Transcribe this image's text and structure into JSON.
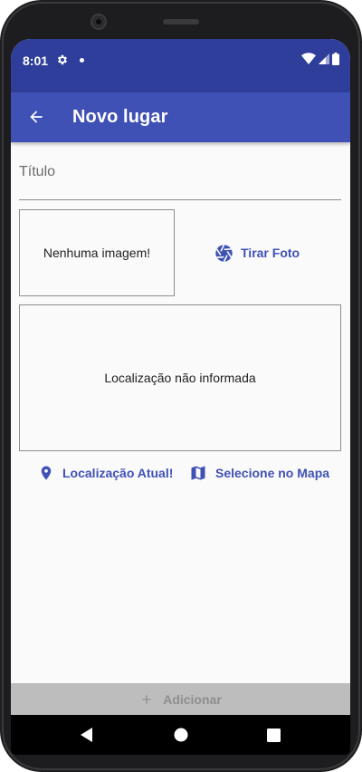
{
  "status_bar": {
    "time": "8:01",
    "icons": [
      "settings-icon",
      "notification-dot-icon",
      "wifi-icon",
      "signal-icon",
      "battery-icon"
    ]
  },
  "app_bar": {
    "title": "Novo lugar",
    "back_icon": "arrow-back-icon"
  },
  "form": {
    "title_placeholder": "Título",
    "title_value": ""
  },
  "image_preview": {
    "empty_text": "Nenhuma imagem!"
  },
  "take_photo": {
    "label": "Tirar Foto",
    "icon": "camera-shutter-icon"
  },
  "location_preview": {
    "empty_text": "Localização não informada"
  },
  "location_actions": {
    "current_label": "Localização Atual!",
    "current_icon": "location-pin-icon",
    "map_label": "Selecione no Mapa",
    "map_icon": "map-icon"
  },
  "submit": {
    "label": "Adicionar",
    "icon": "plus-icon"
  },
  "colors": {
    "primary": "#3f51b5",
    "status_bar": "#2f3e9a",
    "disabled_button": "#bdbdbd",
    "disabled_text": "#8e8e8e"
  }
}
